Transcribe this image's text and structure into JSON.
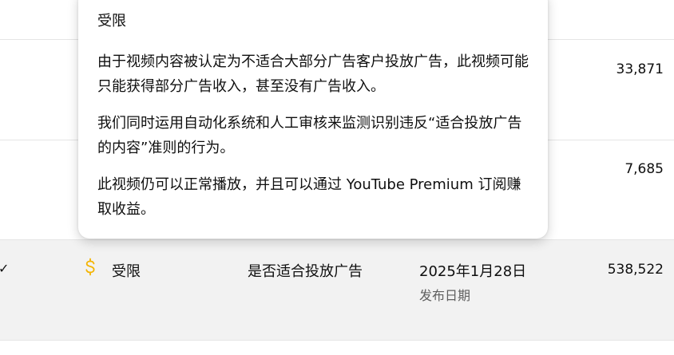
{
  "rows": [
    {
      "views": "33,871"
    },
    {
      "views": "7,685"
    },
    {
      "check": "✓",
      "status": "受限",
      "reason": "是否适合投放广告",
      "date": "2025年1月28日",
      "date_caption": "发布日期",
      "views": "538,522",
      "status_color": "#f4b400"
    }
  ],
  "tooltip": {
    "title": "受限",
    "paragraph1": "由于视频内容被认定为不适合大部分广告客户投放广告，此视频可能只能获得部分广告收入，甚至没有广告收入。",
    "paragraph2": "我们同时运用自动化系统和人工审核来监测识别违反“适合投放广告的内容”准则的行为。",
    "paragraph3": "此视频仍可以正常播放，并且可以通过 YouTube Premium 订阅赚取收益。"
  }
}
